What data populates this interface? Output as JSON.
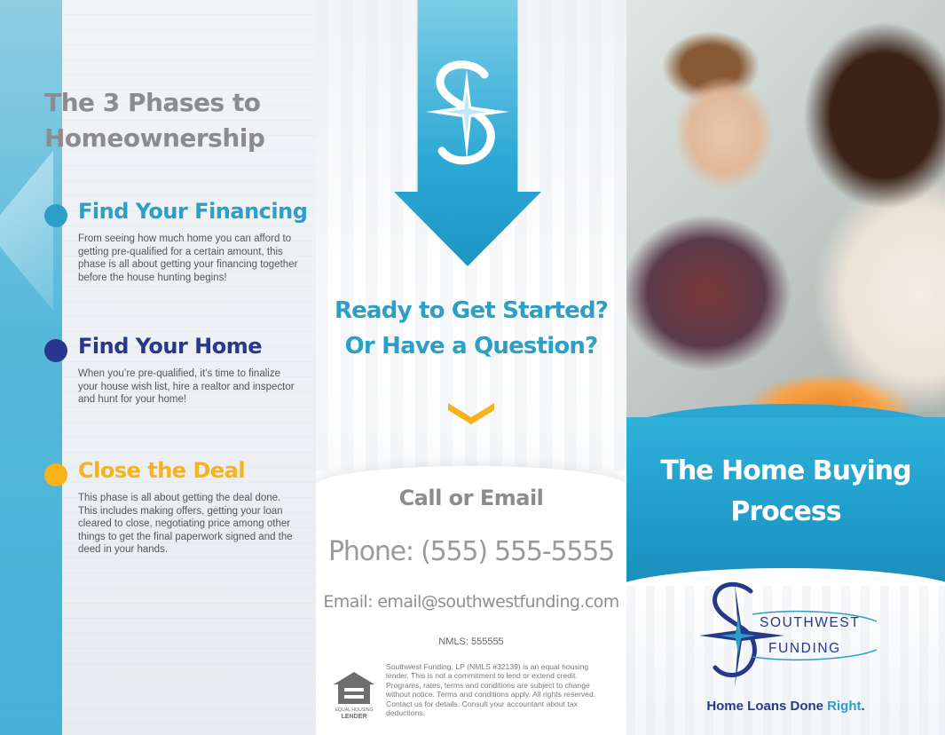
{
  "left_panel": {
    "title_line1": "The 3 Phases to",
    "title_line2": "Homeownership",
    "phases": [
      {
        "title": "Find Your Financing",
        "description": "From seeing how much home you can afford to getting pre-qualified for a certain amount, this phase is all about getting your financing together before the house hunting begins!",
        "dot_color": "#2b9fc7"
      },
      {
        "title": "Find Your Home",
        "description": "When you’re pre-qualified, it’s time to finalize your house wish list, hire a realtor and inspector and hunt for your home!",
        "dot_color": "#27388a"
      },
      {
        "title": "Close the Deal",
        "description": "This phase is all about getting the deal done. This includes making offers, getting your loan cleared to close, negotiating price among other things to get the final paperwork signed and the deed in your hands.",
        "dot_color": "#f7b21c"
      }
    ]
  },
  "middle_panel": {
    "headline_line1": "Ready to Get Started?",
    "headline_line2": "Or Have a Question?",
    "contact": {
      "heading": "Call or Email",
      "phone": "Phone: (555) 555-5555",
      "email": "Email:  email@southwestfunding.com",
      "nmls": "NMLS:  555555"
    },
    "equal_housing_logo_text": [
      "EQUAL HOUSING",
      "LENDER"
    ],
    "disclaimer": "Southwest Funding, LP (NMLS #32139) is an equal housing lender. This is not a commitment to lend or extend credit. Programs, rates, terms and conditions are subject to change without notice. Terms and conditions apply. All rights reserved. Contact us for details. Consult your accountant about tax deductions."
  },
  "right_panel": {
    "cover_title_line1": "The Home Buying",
    "cover_title_line2": "Process",
    "brand": {
      "name_line1": "SOUTHWEST",
      "name_line2": "FUNDING",
      "tagline_main": "Home Loans Done ",
      "tagline_accent": "Right",
      "tagline_end": "."
    }
  },
  "colors": {
    "teal": "#2b9fc7",
    "navy": "#27388a",
    "gold": "#f7b21c",
    "grey_heading": "#8c8c8c"
  },
  "icons": [
    "compass-star-logo-icon",
    "chevron-down-icon",
    "equal-housing-lender-icon"
  ]
}
